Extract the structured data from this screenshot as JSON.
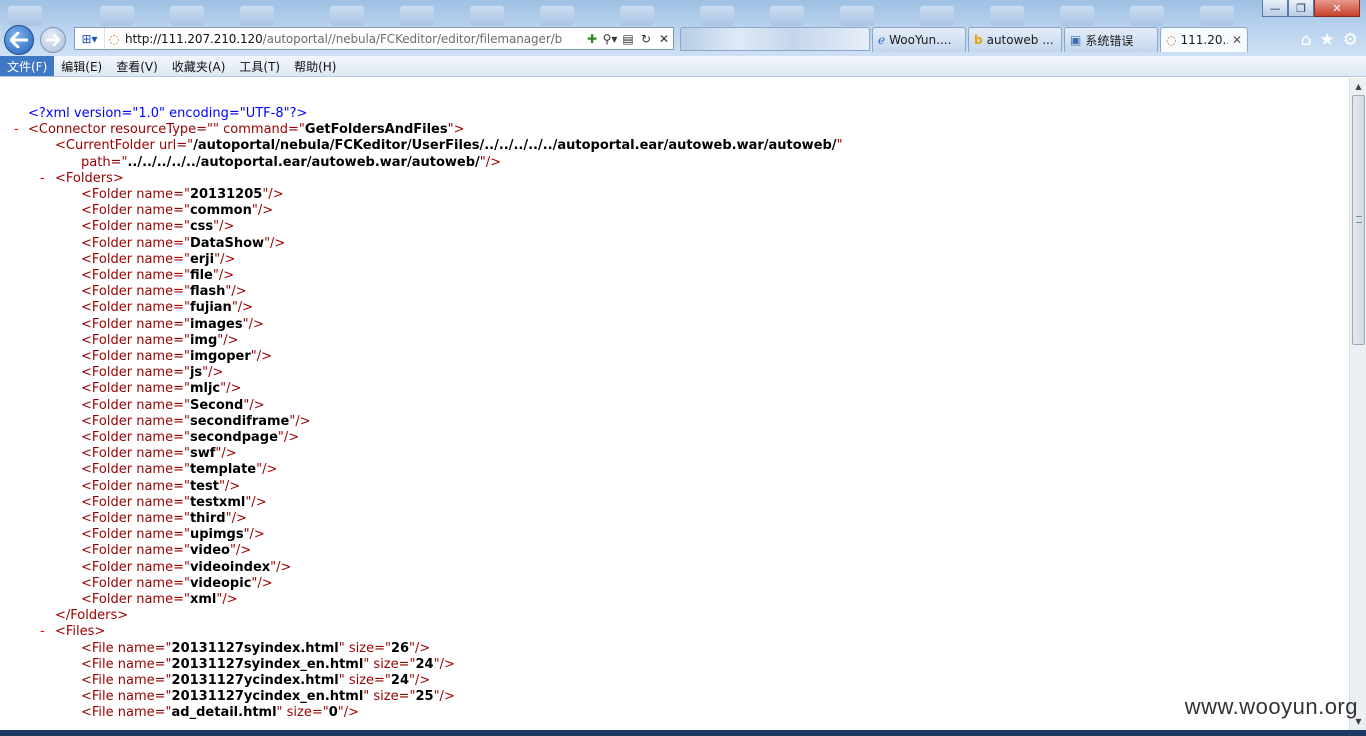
{
  "browser": {
    "address_url_host": "http://111.207.210.120",
    "address_url_path": "/autoportal//nebula/FCKeditor/editor/filemanager/b",
    "tabs": [
      {
        "label": "WooYun....",
        "icon": "ie-icon"
      },
      {
        "label": "autoweb ...",
        "icon": "bing-icon"
      },
      {
        "label": "系统错误",
        "icon": "page-icon"
      },
      {
        "label": "111.20...",
        "icon": "loading-icon",
        "active": true
      }
    ],
    "window_buttons": {
      "minimize": "—",
      "restore": "❐",
      "close": "✕"
    }
  },
  "menu": [
    {
      "label": "文件(F)",
      "active": true
    },
    {
      "label": "编辑(E)"
    },
    {
      "label": "查看(V)"
    },
    {
      "label": "收藏夹(A)"
    },
    {
      "label": "工具(T)"
    },
    {
      "label": "帮助(H)"
    }
  ],
  "xml": {
    "declaration": "<?xml version=\"1.0\" encoding=\"UTF-8\"?>",
    "connector": {
      "resourceType": "",
      "command": "GetFoldersAndFiles"
    },
    "current_folder": {
      "url": "/autoportal/nebula/FCKeditor/UserFiles/../../../../../autoportal.ear/autoweb.war/autoweb/",
      "path": "../../../../../autoportal.ear/autoweb.war/autoweb/"
    },
    "folders": [
      "20131205",
      "common",
      "css",
      "DataShow",
      "erji",
      "file",
      "flash",
      "fujian",
      "images",
      "img",
      "imgoper",
      "js",
      "mljc",
      "Second",
      "secondiframe",
      "secondpage",
      "swf",
      "template",
      "test",
      "testxml",
      "third",
      "upimgs",
      "video",
      "videoindex",
      "videopic",
      "xml"
    ],
    "files": [
      {
        "name": "20131127syindex.html",
        "size": "26"
      },
      {
        "name": "20131127syindex_en.html",
        "size": "24"
      },
      {
        "name": "20131127ycindex.html",
        "size": "24"
      },
      {
        "name": "20131127ycindex_en.html",
        "size": "25"
      },
      {
        "name": "ad_detail.html",
        "size": "0"
      }
    ]
  },
  "watermark": "www.wooyun.org"
}
